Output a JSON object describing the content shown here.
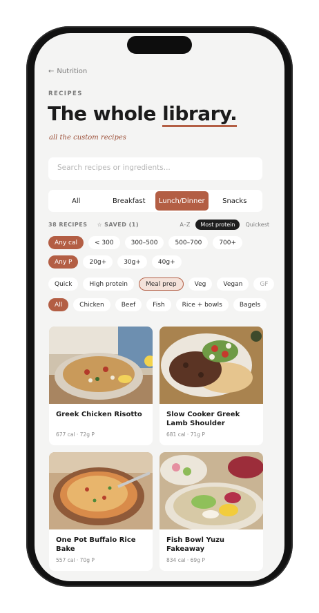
{
  "nav": {
    "back_label": "Nutrition"
  },
  "header": {
    "eyebrow": "RECIPES",
    "title_plain": "The whole ",
    "title_underlined": "library.",
    "subtitle": "all the custom recipes"
  },
  "search": {
    "placeholder": "Search recipes or ingredients..."
  },
  "tabs": [
    {
      "label": "All",
      "active": false
    },
    {
      "label": "Breakfast",
      "active": false
    },
    {
      "label": "Lunch/Dinner",
      "active": true
    },
    {
      "label": "Snacks",
      "active": false
    }
  ],
  "meta": {
    "count": "38 RECIPES",
    "saved": "SAVED (1)",
    "sort": [
      "A–Z",
      "Most protein",
      "Quickest"
    ],
    "sort_active": "Most protein"
  },
  "filters": {
    "calories": [
      "Any cal",
      "< 300",
      "300–500",
      "500–700",
      "700+"
    ],
    "protein": [
      "Any P",
      "20g+",
      "30g+",
      "40g+"
    ],
    "tags": [
      "Quick",
      "High protein",
      "Meal prep",
      "Veg",
      "Vegan",
      "GF"
    ],
    "categories": [
      "All",
      "Chicken",
      "Beef",
      "Fish",
      "Rice + bowls",
      "Bagels"
    ]
  },
  "recipes": [
    {
      "name": "Greek Chicken Risotto",
      "nutrition": "677 cal · 72g P"
    },
    {
      "name": "Slow Cooker Greek Lamb Shoulder",
      "nutrition": "681 cal · 71g P"
    },
    {
      "name": "One Pot Buffalo Rice Bake",
      "nutrition": "557 cal · 70g P"
    },
    {
      "name": "Fish Bowl Yuzu Fakeaway",
      "nutrition": "834 cal · 69g P"
    }
  ],
  "colors": {
    "accent": "#b35e44",
    "background": "#f4f4f3",
    "dark_pill": "#1e1e1e"
  }
}
